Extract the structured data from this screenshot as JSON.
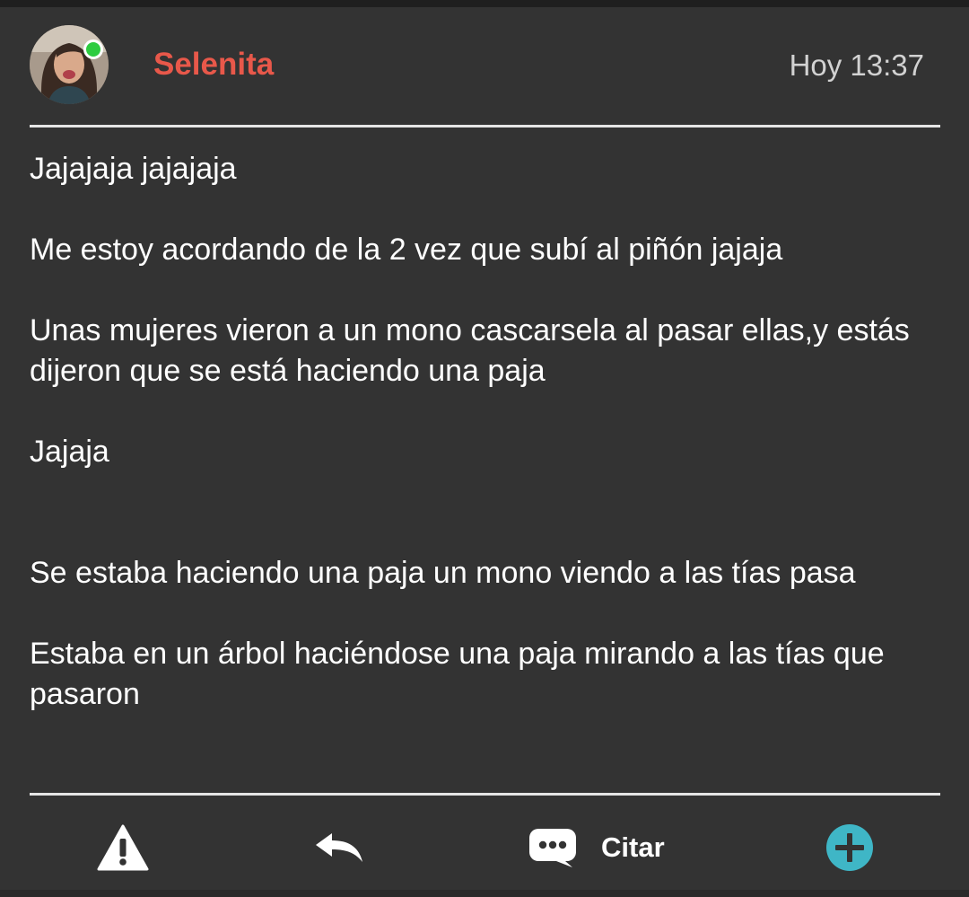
{
  "post": {
    "author": "Selenita",
    "time": "Hoy 13:37",
    "paragraphs": [
      "Jajajaja jajajaja",
      "Me estoy acordando de la 2 vez que subí al piñón jajaja",
      "Unas mujeres vieron a un mono cascarsela al pasar ellas,y estás dijeron que se está haciendo una paja",
      "Jajaja",
      "Se estaba haciendo una paja un mono viendo a las tías pasa",
      "Estaba en un árbol haciéndose una paja mirando a las tías que pasaron"
    ]
  },
  "footer": {
    "report_icon": "warning-icon",
    "reply_icon": "reply-arrow-icon",
    "quote_icon": "speech-bubble-icon",
    "quote_label": "Citar",
    "add_icon": "plus-circle-icon"
  },
  "colors": {
    "background": "#333333",
    "author": "#e8584a",
    "online": "#2ecc40",
    "accent": "#3fb6c6"
  }
}
